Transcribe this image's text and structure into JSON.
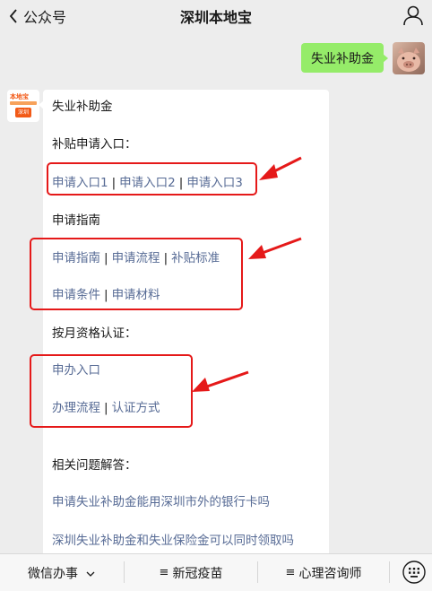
{
  "header": {
    "back_label": "公众号",
    "title": "深圳本地宝"
  },
  "outgoing_message": "失业补助金",
  "bot_logo": {
    "top_text": "本地宝",
    "badge_text": "深圳"
  },
  "card": {
    "heading": "失业补助金",
    "section_apply_entry": {
      "title": "补贴申请入口：",
      "links": [
        "申请入口1",
        "申请入口2",
        "申请入口3"
      ]
    },
    "section_guide": {
      "title": "申请指南",
      "row1": [
        "申请指南",
        "申请流程",
        "补贴标准"
      ],
      "row2": [
        "申请条件",
        "申请材料"
      ]
    },
    "section_monthly": {
      "title": "按月资格认证：",
      "row1": [
        "申办入口"
      ],
      "row2": [
        "办理流程",
        "认证方式"
      ]
    },
    "section_faq": {
      "title": "相关问题解答：",
      "links": [
        "申请失业补助金能用深圳市外的银行卡吗",
        "深圳失业补助金和失业保险金可以同时领取吗"
      ]
    },
    "separator": "|"
  },
  "bottom_menu": {
    "items": [
      "微信办事",
      "新冠疫苗",
      "心理咨询师"
    ]
  },
  "colors": {
    "link": "#576b95",
    "highlight": "#e51919",
    "bubble_green": "#95ec69",
    "page_bg": "#ededed"
  }
}
